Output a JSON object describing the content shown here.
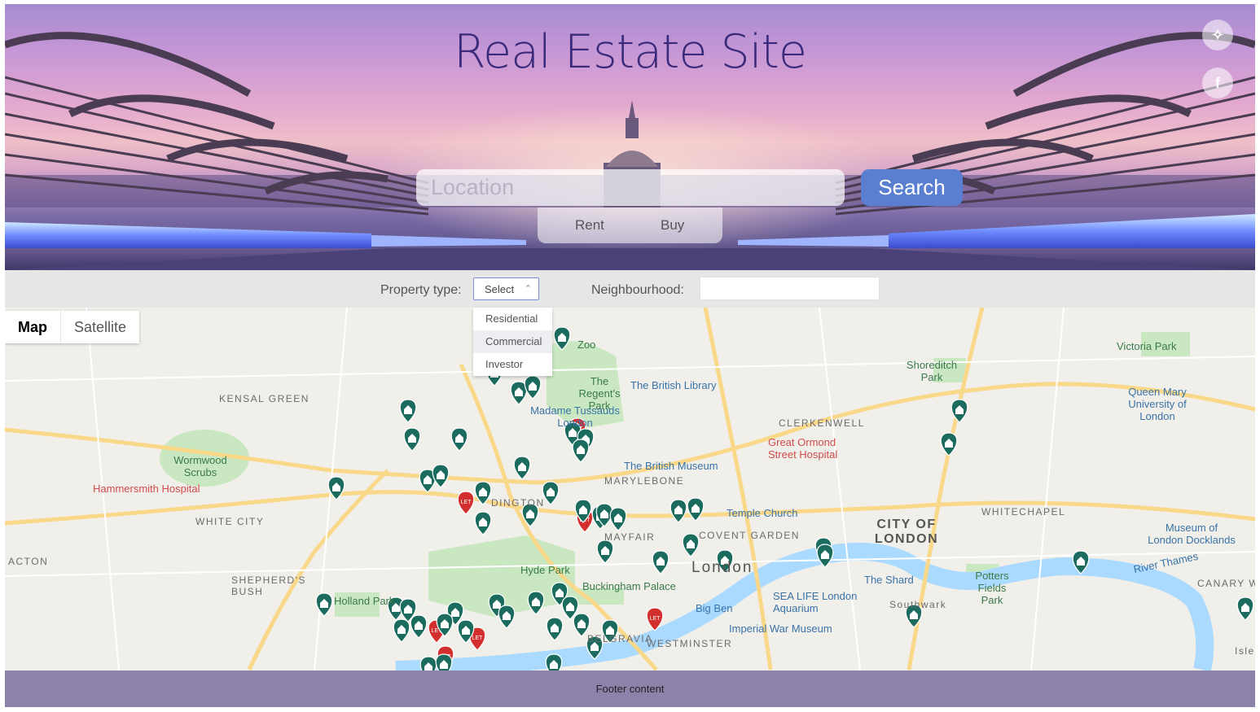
{
  "hero": {
    "title": "Real Estate Site",
    "search_placeholder": "Location",
    "search_button": "Search",
    "toggle_rent": "Rent",
    "toggle_buy": "Buy",
    "social": [
      {
        "icon": "twitter-icon",
        "glyph": "✧"
      },
      {
        "icon": "facebook-icon",
        "glyph": "f"
      }
    ]
  },
  "filters": {
    "property_type_label": "Property type:",
    "property_type_selected": "Select",
    "property_type_options": [
      "Residential",
      "Commercial",
      "Investor"
    ],
    "property_type_highlighted": "Commercial",
    "neighbourhood_label": "Neighbourhood:",
    "neighbourhood_value": ""
  },
  "map": {
    "tabs": [
      "Map",
      "Satellite"
    ],
    "active_tab": "Map",
    "labels": [
      {
        "text": "KENSAL GREEN",
        "kind": "area"
      },
      {
        "text": "Wormwood Scrubs",
        "kind": "park"
      },
      {
        "text": "Hammersmith Hospital",
        "kind": "red"
      },
      {
        "text": "WHITE CITY",
        "kind": "area"
      },
      {
        "text": "ACTON",
        "kind": "area"
      },
      {
        "text": "SHEPHERD'S BUSH",
        "kind": "area"
      },
      {
        "text": "Holland Park",
        "kind": "park"
      },
      {
        "text": "Hyde Park",
        "kind": "park"
      },
      {
        "text": "Buckingham Palace",
        "kind": "park"
      },
      {
        "text": "The Regent's Park",
        "kind": "park"
      },
      {
        "text": "Madame Tussauds London",
        "kind": "poi"
      },
      {
        "text": "Zoo",
        "kind": "park"
      },
      {
        "text": "The British Library",
        "kind": "poi"
      },
      {
        "text": "The British Museum",
        "kind": "poi"
      },
      {
        "text": "MARYLEBONE",
        "kind": "area"
      },
      {
        "text": "DINGTON",
        "kind": "area"
      },
      {
        "text": "MAYFAIR",
        "kind": "area"
      },
      {
        "text": "COVENT GARDEN",
        "kind": "area"
      },
      {
        "text": "Temple Church",
        "kind": "poi"
      },
      {
        "text": "London",
        "kind": "big"
      },
      {
        "text": "CLERKENWELL",
        "kind": "area"
      },
      {
        "text": "Great Ormond Street Hospital",
        "kind": "red"
      },
      {
        "text": "CITY OF LONDON",
        "kind": "city"
      },
      {
        "text": "WHITECHAPEL",
        "kind": "area"
      },
      {
        "text": "Shoreditch Park",
        "kind": "park"
      },
      {
        "text": "Victoria Park",
        "kind": "park"
      },
      {
        "text": "Queen Mary University of London",
        "kind": "poi"
      },
      {
        "text": "Museum of London Docklands",
        "kind": "poi"
      },
      {
        "text": "Potters Fields Park",
        "kind": "park"
      },
      {
        "text": "The Shard",
        "kind": "poi"
      },
      {
        "text": "SEA LIFE London Aquarium",
        "kind": "poi"
      },
      {
        "text": "Big Ben",
        "kind": "poi"
      },
      {
        "text": "Imperial War Museum",
        "kind": "poi"
      },
      {
        "text": "WESTMINSTER",
        "kind": "area"
      },
      {
        "text": "Southwark",
        "kind": "area"
      },
      {
        "text": "CANARY WHAR",
        "kind": "area"
      },
      {
        "text": "River Thames",
        "kind": "poi"
      },
      {
        "text": "Isle",
        "kind": "area"
      },
      {
        "text": "BELGRAVIA",
        "kind": "area"
      }
    ],
    "marker_let_label": "LET"
  },
  "footer": {
    "text": "Footer content"
  },
  "colors": {
    "marker_house": "#1b6b5e",
    "marker_let": "#d32f2f",
    "search_button": "#5a7fd0",
    "footer": "#8c82aa"
  }
}
